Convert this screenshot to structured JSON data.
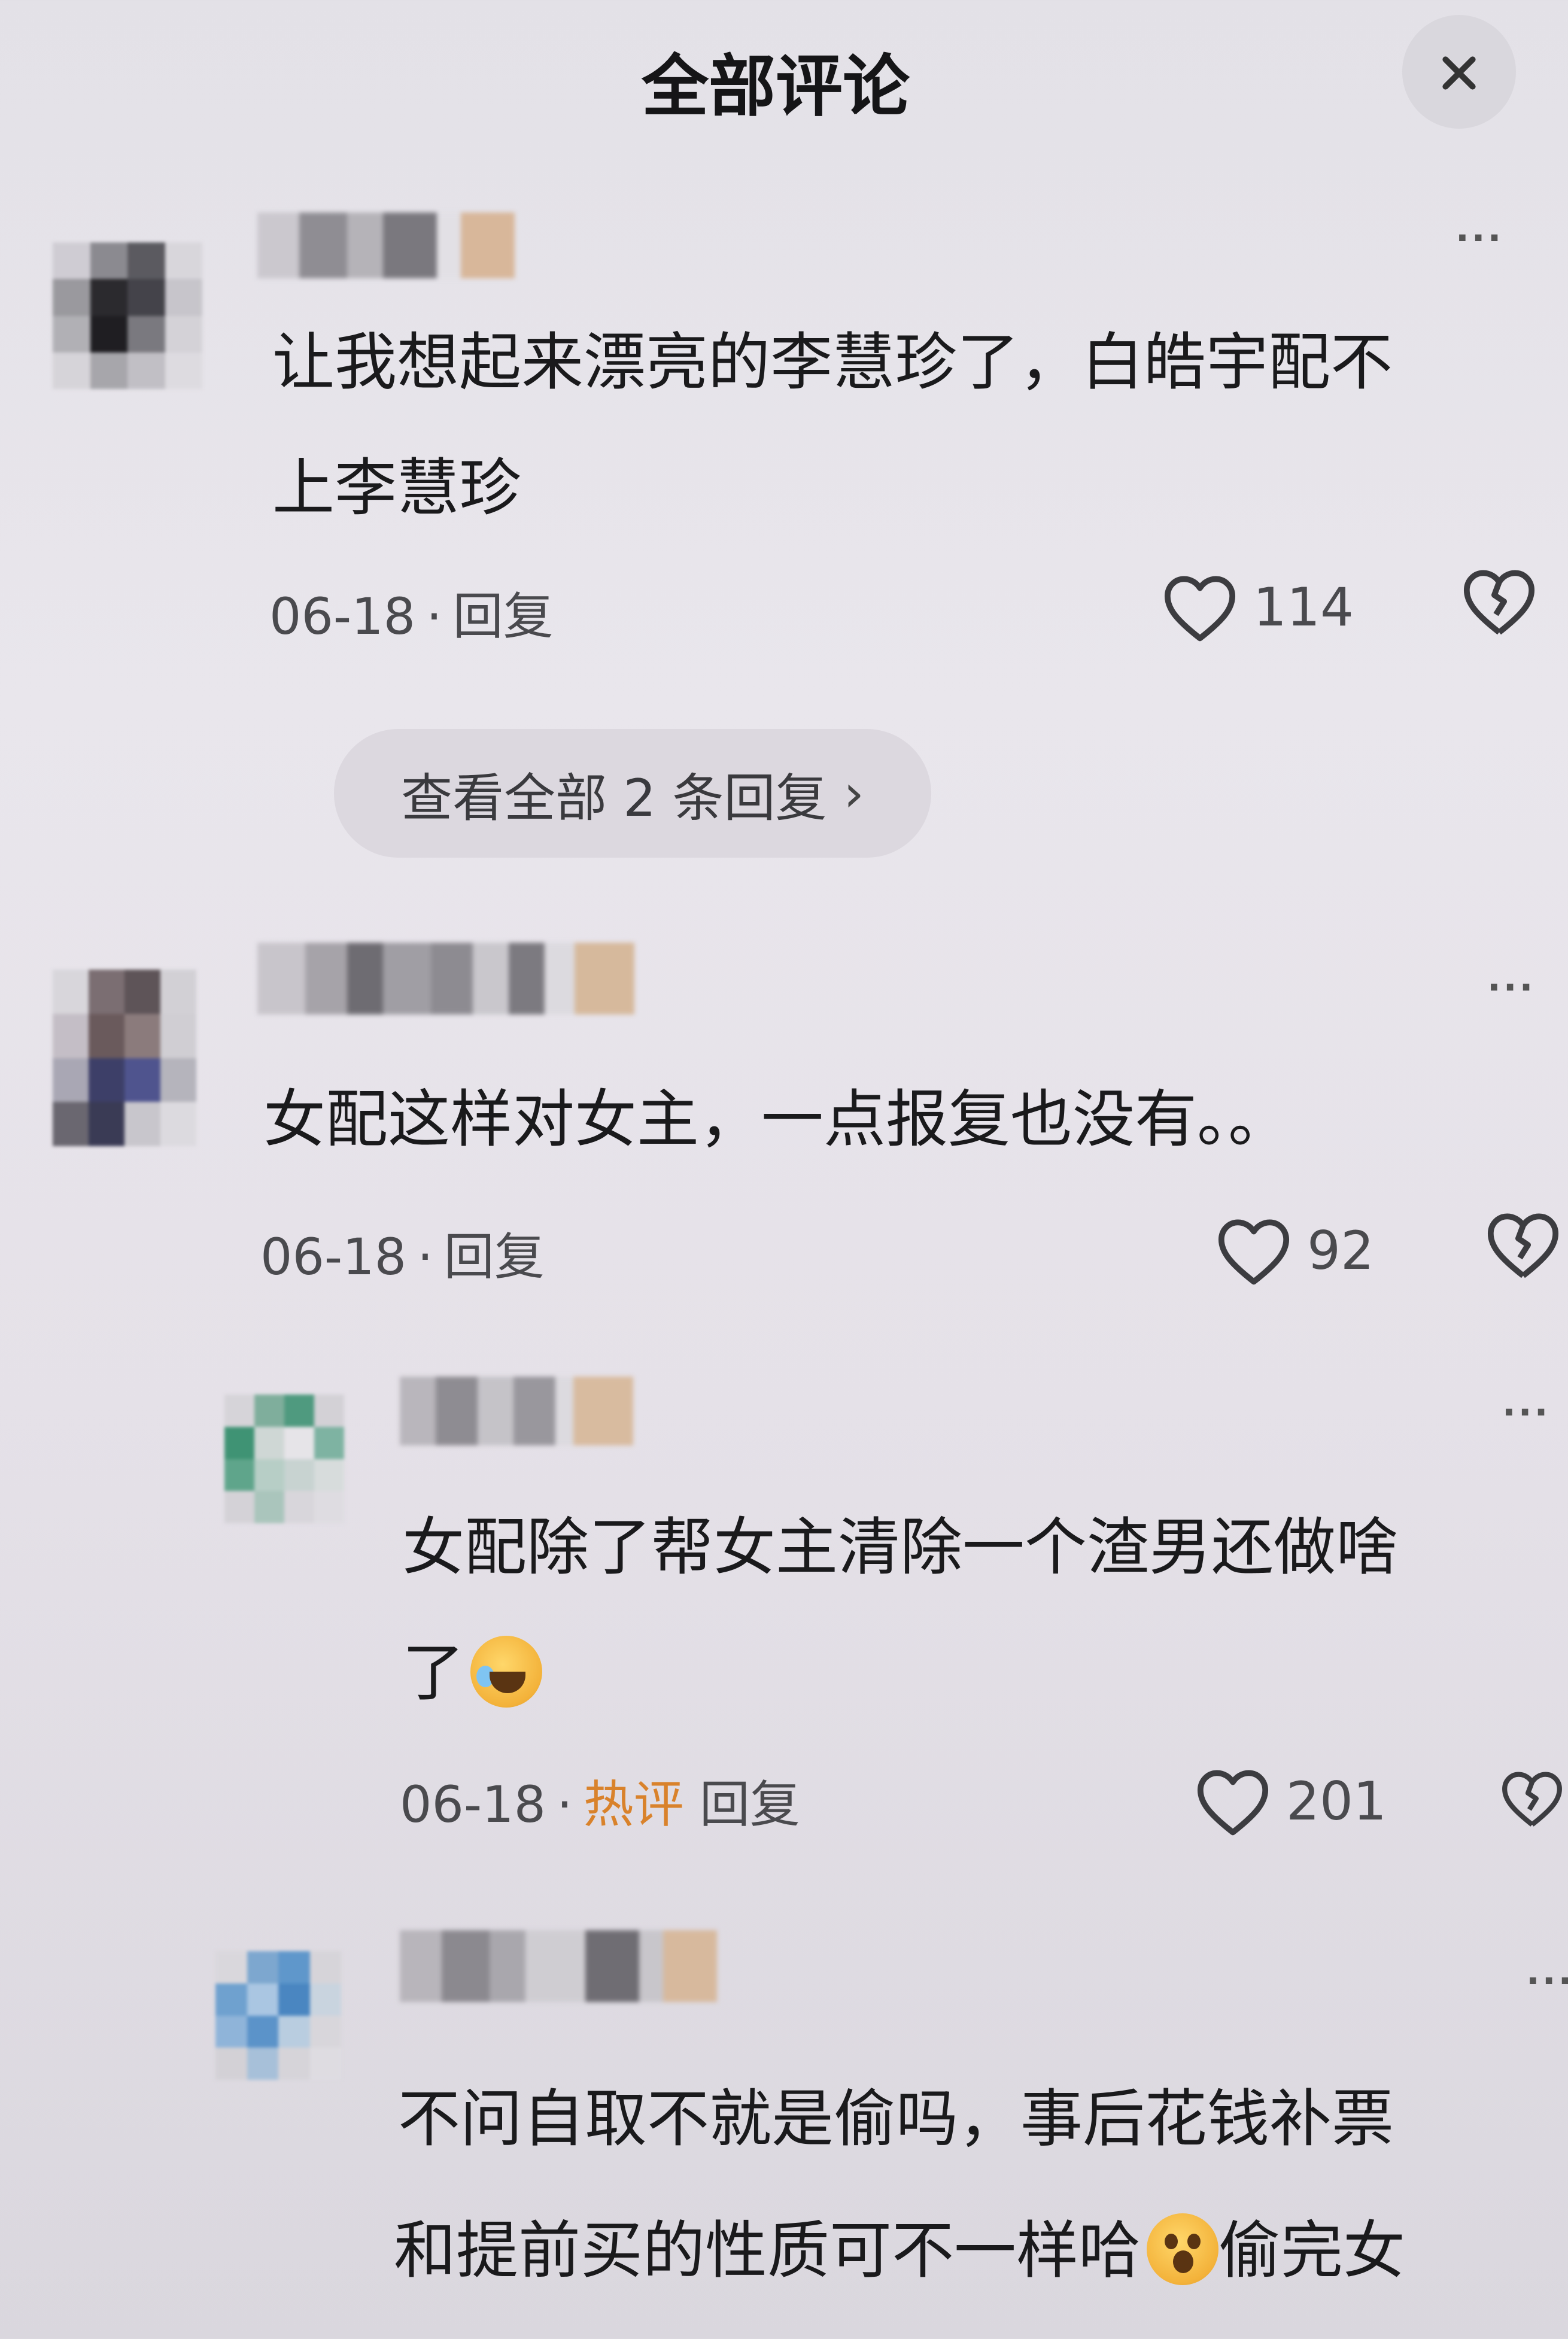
{
  "header": {
    "title": "全部评论",
    "close_icon": "close-icon"
  },
  "comments": [
    {
      "text_lines": [
        "让我想起来漂亮的李慧珍了，白皓宇配不",
        "上李慧珍"
      ],
      "date": "06-18",
      "dot": "·",
      "reply": "回复",
      "likes": "114"
    },
    {
      "text_lines": [
        "女配这样对女主，一点报复也没有。。"
      ],
      "date": "06-18",
      "dot": "·",
      "reply": "回复",
      "likes": "92"
    }
  ],
  "view_replies": {
    "label": "查看全部 2 条回复",
    "chevron": "›"
  },
  "replies": [
    {
      "text_line1": "女配除了帮女主清除一个渣男还做啥",
      "text_line2": "了",
      "emoji": "cry-laughing-emoji-icon",
      "date": "06-18",
      "dot": "·",
      "tag": "热评",
      "reply": "回复",
      "likes": "201"
    },
    {
      "text_line1": "不问自取不就是偷吗，事后花钱补票",
      "text_line2_a": "和提前买的性质可不一样哈",
      "emoji": "shocked-emoji-icon",
      "text_line2_b": "偷完女"
    }
  ],
  "more_label": "···",
  "colors": {
    "hot_tag": "#d9822b",
    "background": "#e7e4ea",
    "text": "#1a1a1c",
    "meta": "#4a4a4e"
  }
}
